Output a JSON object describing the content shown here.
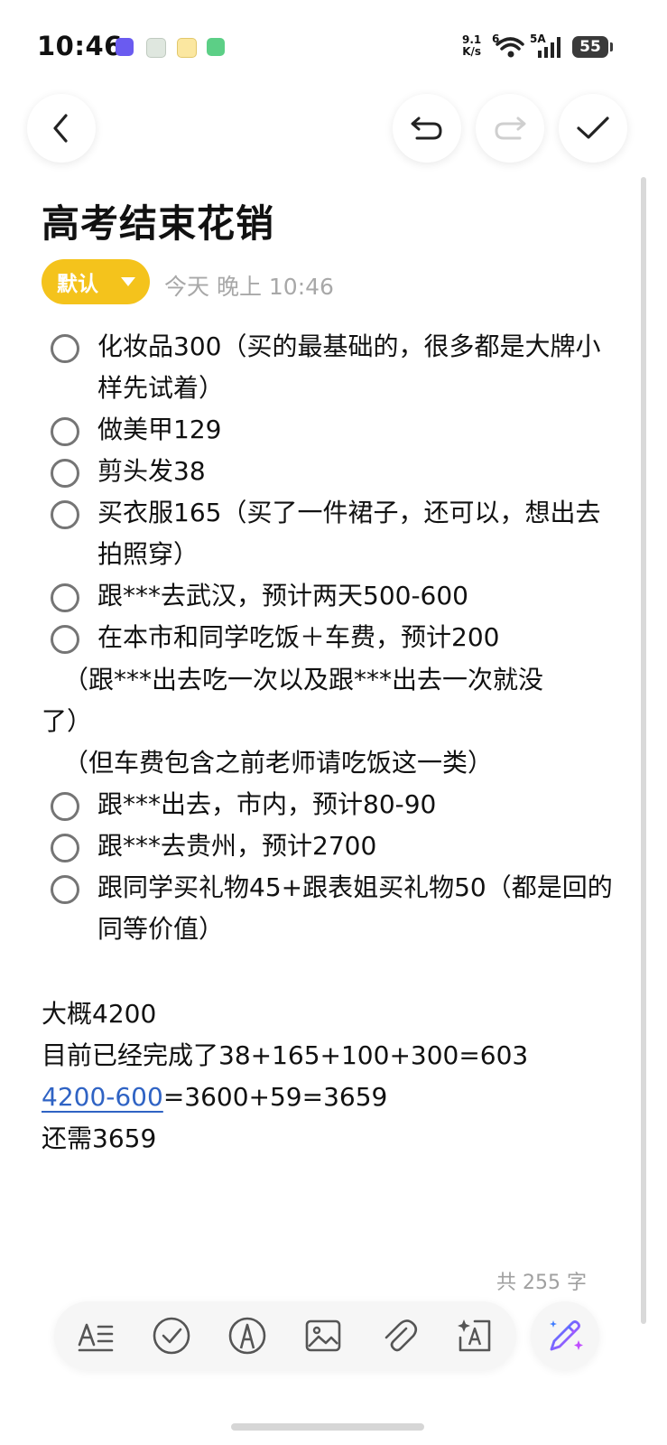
{
  "status": {
    "time": "10:46",
    "net_speed_top": "9.1",
    "net_speed_bottom": "K/s",
    "wifi_label": "6",
    "signal_label": "5A",
    "battery": "55"
  },
  "note": {
    "title": "高考结束花销",
    "category": "默认",
    "timestamp": "今天 晚上 10:46",
    "items": [
      {
        "text": "化妆品300（买的最基础的，很多都是大牌小样先试着）",
        "checked": false
      },
      {
        "text": "做美甲129",
        "checked": false
      },
      {
        "text": "剪头发38",
        "checked": false
      },
      {
        "text": "买衣服165（买了一件裙子，还可以，想出去拍照穿）",
        "checked": false
      },
      {
        "text": "跟***去武汉，预计两天500-600",
        "checked": false
      },
      {
        "text": "在本市和同学吃饭＋车费，预计200",
        "checked": false
      },
      {
        "text": "跟***出去，市内，预计80-90",
        "checked": false
      },
      {
        "text": "跟***去贵州，预计2700",
        "checked": false
      },
      {
        "text": "跟同学买礼物45+跟表姐买礼物50（都是回的同等价值）",
        "checked": false
      }
    ],
    "sub_line_1a": "（跟***出去吃一次以及跟***出去一次就没",
    "sub_line_1b": "了）",
    "sub_line_2": "（但车费包含之前老师请吃饭这一类）",
    "summary_1": "大概4200",
    "summary_2": "目前已经完成了38+165+100+300=603",
    "summary_3_link": "4200-600",
    "summary_3_rest": "=3600+59=3659",
    "summary_4": "还需3659",
    "word_count": "共 255 字"
  },
  "colors": {
    "accent": "#f4c31c",
    "link": "#2f63c4"
  }
}
